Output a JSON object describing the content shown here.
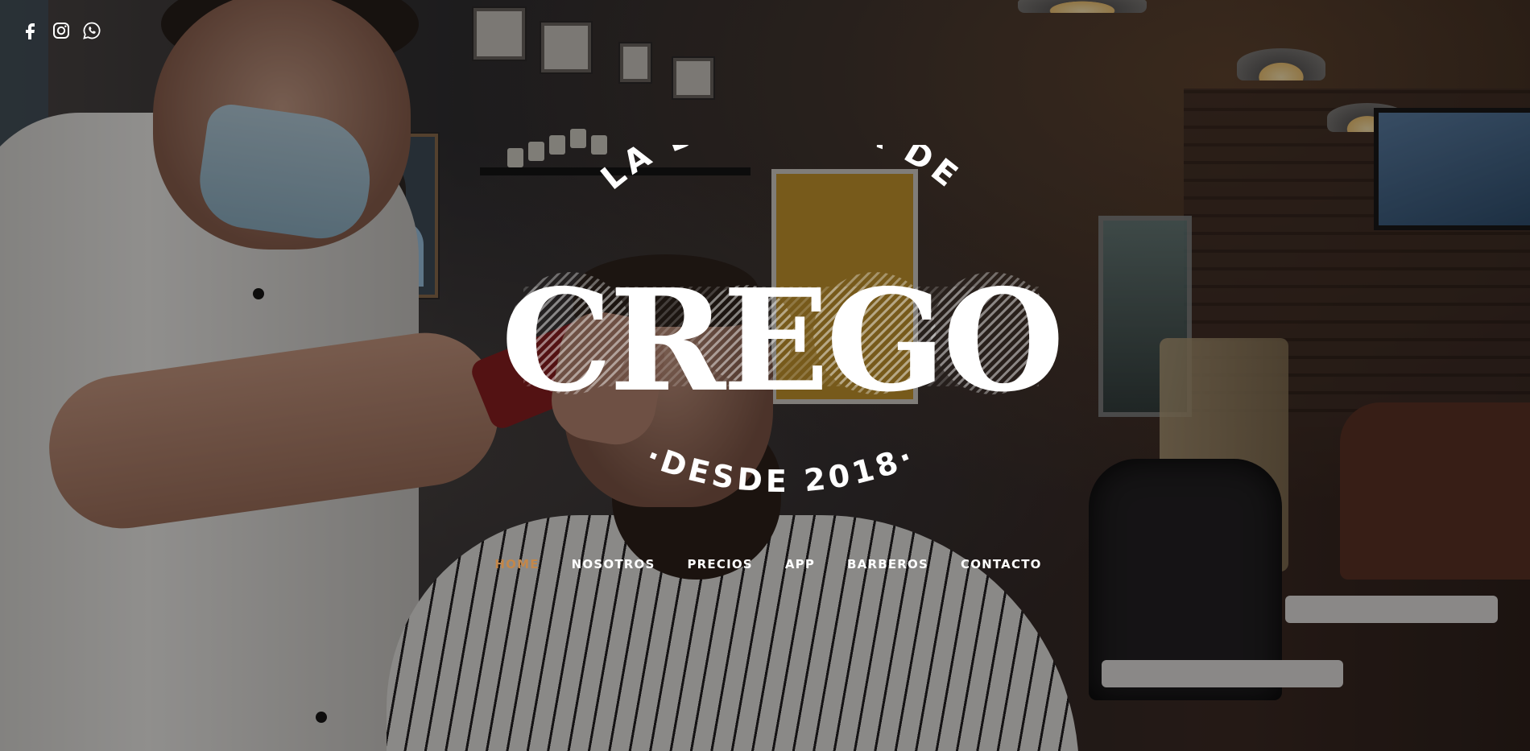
{
  "social": {
    "icons": [
      "facebook-icon",
      "instagram-icon",
      "whatsapp-icon"
    ]
  },
  "logo": {
    "top_arc": "LA BARBERÍA DE",
    "name": "CREGO",
    "bottom_arc": "·DESDE 2018·"
  },
  "nav": {
    "items": [
      {
        "label": "HOME",
        "active": true
      },
      {
        "label": "NOSOTROS",
        "active": false
      },
      {
        "label": "PRECIOS",
        "active": false
      },
      {
        "label": "APP",
        "active": false
      },
      {
        "label": "BARBEROS",
        "active": false
      },
      {
        "label": "CONTACTO",
        "active": false
      }
    ],
    "active_color": "#c3874a",
    "text_color": "#ffffff"
  }
}
